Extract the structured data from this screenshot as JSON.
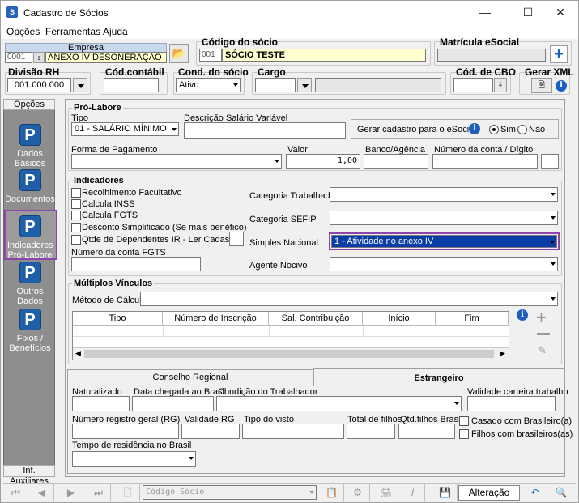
{
  "window": {
    "title": "Cadastro de Sócios"
  },
  "menu": [
    "Opções",
    "Ferramentas",
    "Ajuda"
  ],
  "empresa": {
    "label": "Empresa",
    "code": "0001",
    "name": "ANEXO IV DESONERAÇÃO"
  },
  "codigo_socio": {
    "label": "Código do sócio",
    "code": "001",
    "name": "SÓCIO TESTE"
  },
  "matricula": {
    "label": "Matrícula eSocial",
    "value": ""
  },
  "divisao_rh": {
    "label": "Divisão RH",
    "value": "001.000.000"
  },
  "cod_contabil": {
    "label": "Cód.contábil",
    "value": ""
  },
  "cond_socio": {
    "label": "Cond. do sócio",
    "value": "Ativo"
  },
  "cargo": {
    "label": "Cargo",
    "value": ""
  },
  "cod_cbo": {
    "label": "Cód. de CBO",
    "value": ""
  },
  "gerar_xml": {
    "label": "Gerar XML"
  },
  "sidebar": {
    "header": "Opções",
    "items": [
      {
        "label": "Dados Básicos"
      },
      {
        "label": "Documentos"
      },
      {
        "label": "Indicadores Pró-Labore"
      },
      {
        "label": "Outros Dados"
      },
      {
        "label": "Fixos / Benefícios"
      }
    ],
    "footer": "Inf. Auxiliares"
  },
  "prolabore": {
    "title": "Pró-Labore",
    "tipo_label": "Tipo",
    "tipo_value": "01 - SALÁRIO MÍNIMO",
    "desc_label": "Descrição Salário Variável",
    "desc_value": "",
    "esocial_label": "Gerar cadastro para o eSocial:",
    "sim": "Sim",
    "nao": "Não",
    "forma_label": "Forma de Pagamento",
    "forma_value": "",
    "valor_label": "Valor",
    "valor_value": "1,00",
    "banco_label": "Banco/Agência",
    "banco_value": "",
    "conta_label": "Número da conta / Dígito",
    "conta_value": "",
    "digito_value": ""
  },
  "indicadores": {
    "title": "Indicadores",
    "checks": [
      "Recolhimento Facultativo",
      "Calcula INSS",
      "Calcula FGTS",
      "Desconto Simplificado (Se mais benéfico)",
      "Qtde de Dependentes IR - Ler Cadastro"
    ],
    "qtde_value": "",
    "fgts_label": "Número da conta FGTS",
    "fgts_value": "",
    "cat_trab_label": "Categoria Trabalhador",
    "cat_trab_value": "",
    "cat_sefip_label": "Categoria SEFIP",
    "cat_sefip_value": "",
    "simples_label": "Simples Nacional",
    "simples_value": "1 - Atividade no anexo IV",
    "agente_label": "Agente Nocivo",
    "agente_value": ""
  },
  "multiplos": {
    "title": "Múltiplos Vínculos",
    "metodo_label": "Método de Cálculo",
    "metodo_value": "",
    "columns": [
      "Tipo",
      "Número de Inscrição",
      "Sal. Contribuição",
      "Início",
      "Fim"
    ]
  },
  "tabs": {
    "conselho": "Conselho Regional",
    "estrangeiro": "Estrangeiro"
  },
  "estrangeiro": {
    "naturalizado": "Naturalizado",
    "data_chegada": "Data chegada ao Brasil",
    "condicao": "Condição do Trabalhador",
    "validade_cart": "Validade carteira trabalho",
    "rg": "Número registro geral (RG)",
    "validade_rg": "Validade RG",
    "tipo_visto": "Tipo do visto",
    "total_filhos": "Total de filhos",
    "qtd_filhos": "Qtd.filhos Brasil",
    "casado": "Casado com Brasileiro(a)",
    "filhos_br": "Filhos com brasileiros(as)",
    "tempo": "Tempo de residência no Brasil"
  },
  "toolbar": {
    "search_placeholder": "Código Sócio",
    "status": "Alteração"
  },
  "colors": {
    "highlight_border": "#8e44ad",
    "selected_bg": "#0a3ea6",
    "sidebar_bg": "#8e8e8e",
    "icon_blue": "#1f5fa8"
  }
}
